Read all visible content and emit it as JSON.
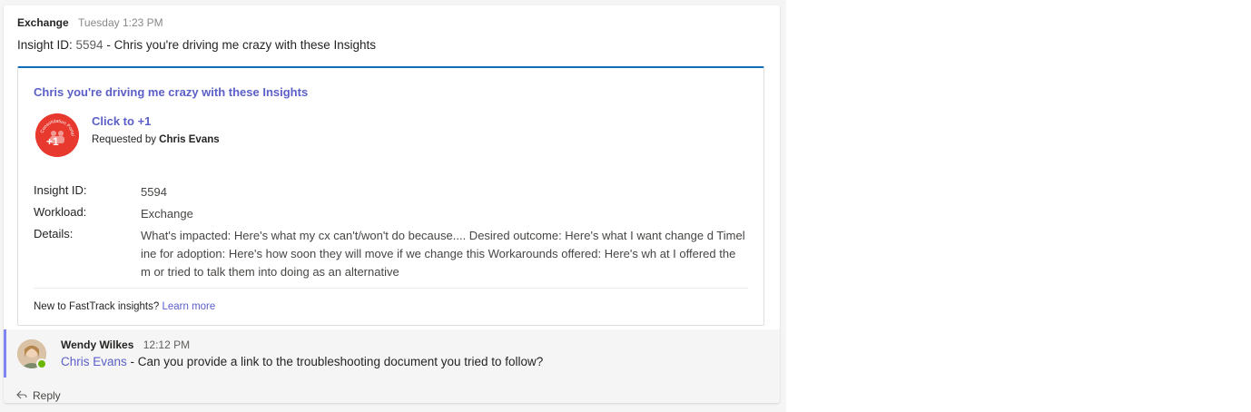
{
  "post": {
    "author": "Exchange",
    "time": "Tuesday 1:23 PM",
    "body_prefix": "Insight ID: ",
    "body_id": "5594",
    "body_suffix": " - Chris you're driving me crazy with these Insights"
  },
  "card": {
    "title": "Chris you're driving me crazy with these Insights",
    "badge_text": "Consolidation Portal",
    "badge_plus": "+1",
    "click_label": "Click to +1",
    "requested_prefix": "Requested by ",
    "requested_by": "Chris Evans",
    "fields": [
      {
        "key": "Insight ID:",
        "value": "5594"
      },
      {
        "key": "Workload:",
        "value": "Exchange"
      },
      {
        "key": "Details:",
        "value": "What's impacted: Here's what my cx can't/won't do because.... Desired outcome: Here's what I want change d Timeline for adoption: Here's how soon they will move if we change this Workarounds offered: Here's wh at I offered them or tried to talk them into doing as an alternative"
      }
    ],
    "footer_text": "New to FastTrack insights? ",
    "footer_link": "Learn more"
  },
  "reply": {
    "author": "Wendy Wilkes",
    "time": "12:12 PM",
    "mention": "Chris Evans",
    "text": " - Can you provide a link to the troubleshooting document you tried to follow?",
    "reply_label": "Reply"
  },
  "colors": {
    "accent": "#5b5fc7",
    "card_top_border": "#0f6cbd",
    "badge": "#e8392f",
    "presence": "#6bb700"
  }
}
